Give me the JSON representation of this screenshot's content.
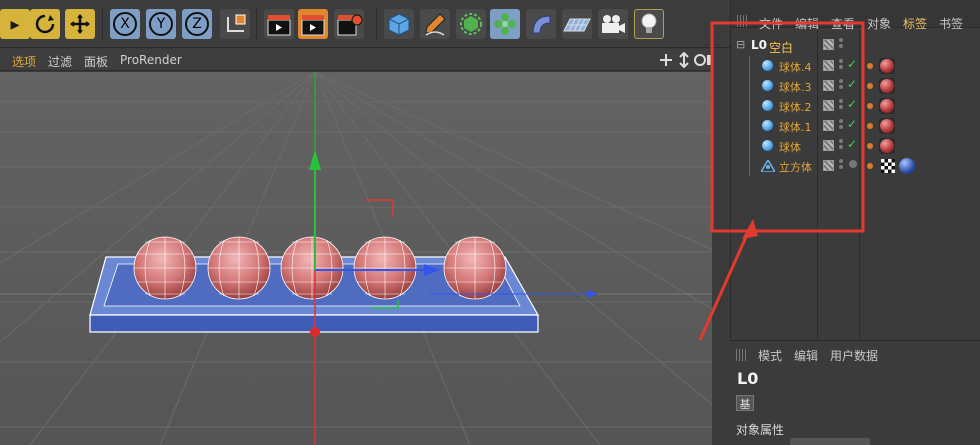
{
  "toolbar": {
    "axis_x": "X",
    "axis_y": "Y",
    "axis_z": "Z"
  },
  "view_menu": [
    "选项",
    "过滤",
    "面板",
    "ProRender"
  ],
  "object_manager": {
    "menu": [
      "文件",
      "编辑",
      "查看",
      "对象",
      "标签",
      "书签"
    ],
    "active_menu_index": 4,
    "null_object": "空白",
    "objects": [
      {
        "name": "球体.4",
        "checked": true,
        "material": true
      },
      {
        "name": "球体.3",
        "checked": true,
        "material": true
      },
      {
        "name": "球体.2",
        "checked": true,
        "material": true
      },
      {
        "name": "球体.1",
        "checked": true,
        "material": true
      },
      {
        "name": "球体",
        "checked": true,
        "material": true
      },
      {
        "name": "立方体",
        "checked": false,
        "material": true
      }
    ]
  },
  "attribute_manager": {
    "menu": [
      "模式",
      "编辑",
      "用户数据"
    ],
    "section_label": "对象属性",
    "tab_letter": "基"
  },
  "colors": {
    "annotation_red": "#e33a2f",
    "label_orange": "#e3a33a",
    "toolbar_yellow": "#d6b43c",
    "toolbar_blue": "#7f9ec6"
  }
}
